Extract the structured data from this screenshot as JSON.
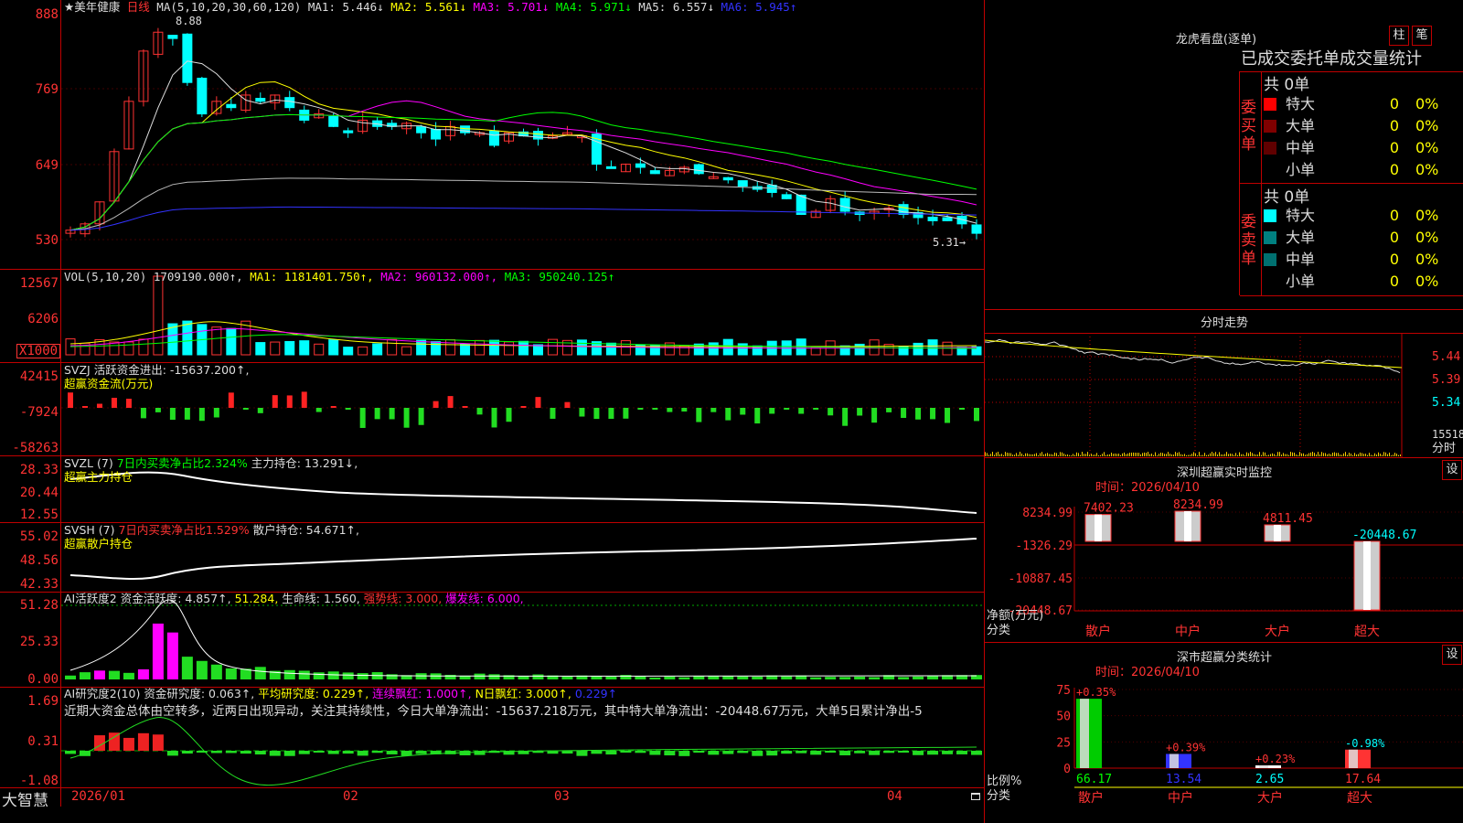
{
  "stock": {
    "name": "★美年健康",
    "period": "日线",
    "ma_label": "MA(5,10,20,30,60,120)",
    "ma_values": [
      {
        "label": "MA1: 5.446↓",
        "color": "#dddddd"
      },
      {
        "label": "MA2: 5.561↓",
        "color": "#ffff00"
      },
      {
        "label": "MA3: 5.701↓",
        "color": "#ff00ff"
      },
      {
        "label": "MA4: 5.971↓",
        "color": "#00ff00"
      },
      {
        "label": "MA5: 6.557↓",
        "color": "#dddddd"
      },
      {
        "label": "MA6: 5.945↑",
        "color": "#3333ff"
      }
    ],
    "high_label": "8.88",
    "last_label": "5.31→",
    "price_axis": [
      "888",
      "769",
      "649",
      "530"
    ]
  },
  "vol": {
    "header": "VOL(5,10,20)",
    "values": [
      {
        "label": "1709190.000↑,",
        "color": "#dddddd"
      },
      {
        "label": "MA1: 1181401.750↑,",
        "color": "#ffff00"
      },
      {
        "label": "MA2: 960132.000↑,",
        "color": "#ff00ff"
      },
      {
        "label": "MA3: 950240.125↑",
        "color": "#00ff00"
      }
    ],
    "axis": [
      "12567",
      "6206"
    ],
    "unit": "X1000"
  },
  "svzj": {
    "header": "SVZJ  活跃资金进出: -15637.200↑,",
    "sub": "超赢资金流(万元)",
    "axis": [
      "42415",
      "-7924",
      "-58263"
    ]
  },
  "svzl": {
    "header_a": "SVZL (7)",
    "header_b": "7日内买卖净占比2.324%",
    "header_c": "主力持仓: 13.291↓,",
    "sub": "超赢主力持仓",
    "axis": [
      "28.33",
      "20.44",
      "12.55"
    ]
  },
  "svsh": {
    "header_a": "SVSH (7)",
    "header_b": "7日内买卖净占比1.529%",
    "header_c": "散户持仓: 54.671↑,",
    "sub": "超赢散户持仓",
    "axis": [
      "55.02",
      "48.56",
      "42.33"
    ]
  },
  "ai1": {
    "header_a": "AI活跃度2",
    "header_b": "资金活跃度: 4.857↑,",
    "header_c": "51.284,",
    "header_d": "生命线: 1.560,",
    "header_e": "强势线: 3.000,",
    "header_f": "爆发线: 6.000,",
    "axis": [
      "51.28",
      "25.33",
      "0.00"
    ]
  },
  "ai2": {
    "header_a": "AI研究度2(10)",
    "header_b": "资金研究度: 0.063↑,",
    "header_c": "平均研究度: 0.229↑,",
    "header_d": "连续飘红: 1.000↑,",
    "header_e": "N日飘红: 3.000↑,",
    "header_f": "0.229↑",
    "comment": "近期大资金总体由空转多，近两日出现异动，关注其持续性，今日大单净流出：-15637.218万元，其中特大单净流出：-20448.67万元，大单5日累计净出-5",
    "axis": [
      "1.69",
      "0.31",
      "-1.08"
    ]
  },
  "dates": [
    "2026/01",
    "02",
    "03",
    "04"
  ],
  "brand": "大智慧",
  "lhb": {
    "title": "龙虎看盘(逐单)",
    "btn_a": "柱",
    "btn_b": "笔",
    "heading": "已成交委托单成交量统计",
    "buy_label": "委买单",
    "sell_label": "委卖单",
    "buy_total": "共 0单",
    "sell_total": "共 0单",
    "buy_rows": [
      {
        "name": "特大",
        "count": "0",
        "pct": "0%",
        "color": "#ff0000"
      },
      {
        "name": "大单",
        "count": "0",
        "pct": "0%",
        "color": "#800000"
      },
      {
        "name": "中单",
        "count": "0",
        "pct": "0%",
        "color": "#600000"
      },
      {
        "name": "小单",
        "count": "0",
        "pct": "0%",
        "color": "#000000"
      }
    ],
    "sell_rows": [
      {
        "name": "特大",
        "count": "0",
        "pct": "0%",
        "color": "#00ffff"
      },
      {
        "name": "大单",
        "count": "0",
        "pct": "0%",
        "color": "#008080"
      },
      {
        "name": "中单",
        "count": "0",
        "pct": "0%",
        "color": "#007070"
      },
      {
        "name": "小单",
        "count": "0",
        "pct": "0%",
        "color": "#000000"
      }
    ]
  },
  "intraday": {
    "title": "分时走势",
    "axis": [
      "5.44",
      "5.39",
      "5.34"
    ],
    "vol_label": "15518",
    "vol_unit": "分时"
  },
  "sz_monitor": {
    "title": "深圳超赢实时监控",
    "btn": "设",
    "time": "时间：2026/04/10",
    "axis": [
      "8234.99",
      "-1326.29",
      "-10887.45",
      "-20448.67"
    ],
    "unit_a": "净额(万元)",
    "unit_b": "分类"
  },
  "sz_stats": {
    "title": "深市超赢分类统计",
    "btn": "设",
    "time": "时间：2026/04/10",
    "axis": [
      "75",
      "50",
      "25",
      "0"
    ],
    "unit_a": "比例%",
    "unit_b": "分类"
  },
  "chart_data": [
    {
      "type": "bar",
      "title": "深圳超赢实时监控",
      "categories": [
        "散户",
        "中户",
        "大户",
        "超大"
      ],
      "values": [
        7402.23,
        8234.99,
        4811.45,
        -20448.67
      ],
      "ylabel": "净额(万元)",
      "ylim": [
        -20448.67,
        8234.99
      ]
    },
    {
      "type": "bar",
      "title": "深市超赢分类统计",
      "categories": [
        "散户",
        "中户",
        "大户",
        "超大"
      ],
      "values": [
        66.17,
        13.54,
        2.65,
        17.64
      ],
      "changes": [
        "+0.35%",
        "+0.39%",
        "+0.23%",
        "-0.98%"
      ],
      "colors": [
        "#00cc00",
        "#3333ff",
        "#ffffff",
        "#ff3333"
      ],
      "ylabel": "比例%",
      "ylim": [
        0,
        75
      ]
    }
  ]
}
